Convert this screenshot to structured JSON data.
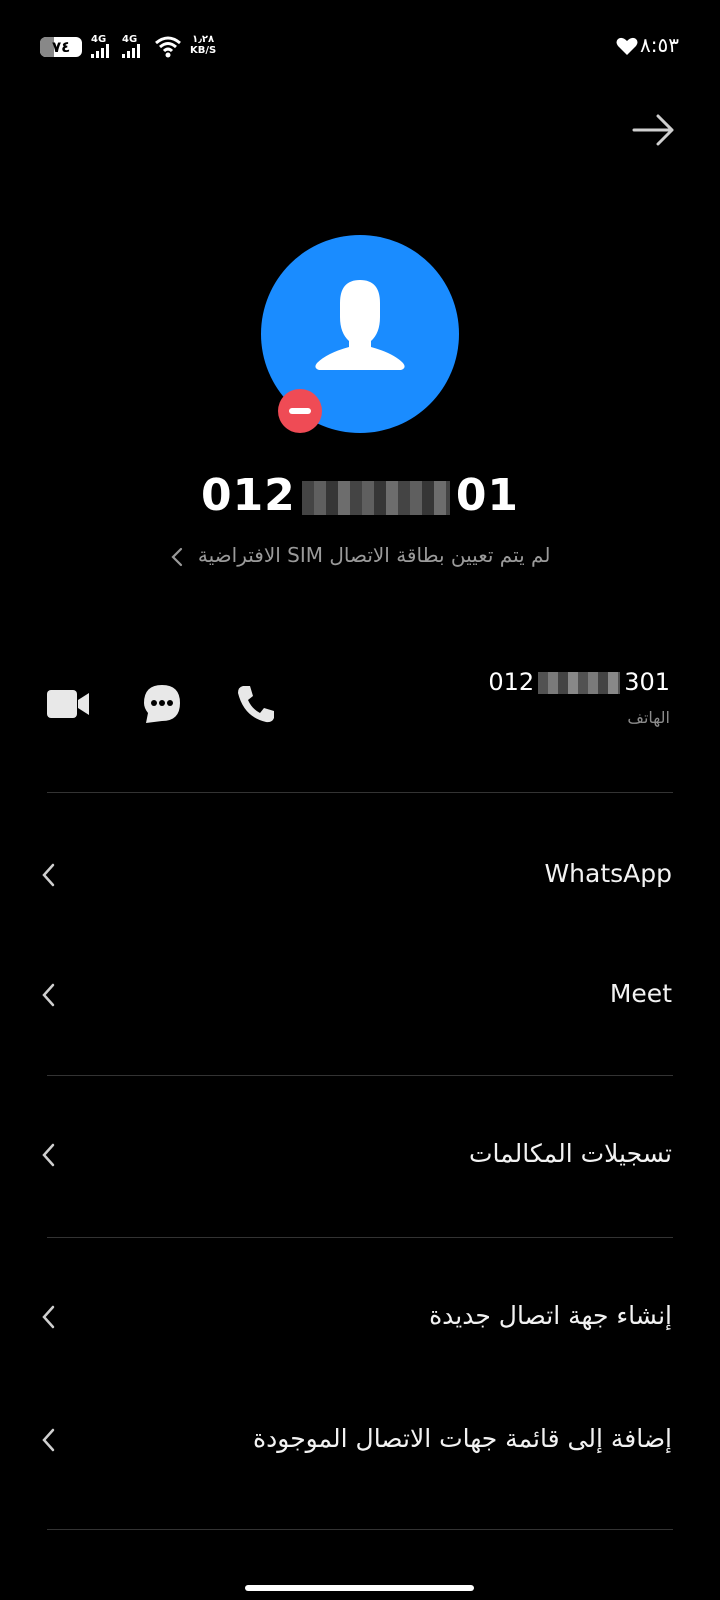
{
  "status_bar": {
    "battery": "٧٤",
    "net1": "4G",
    "net2": "4G",
    "speed_value": "١٫٢٨",
    "speed_unit": "KB/S",
    "time": "٨:٥٣"
  },
  "contact": {
    "number_prefix": "012",
    "number_suffix": "01",
    "sim_notice": "لم يتم تعيين بطاقة الاتصال SIM الافتراضية",
    "phone_prefix": "012",
    "phone_suffix": "301",
    "phone_label": "الهاتف"
  },
  "menu": {
    "whatsapp": "WhatsApp",
    "meet": "Meet",
    "call_recordings": "تسجيلات المكالمات",
    "create_contact": "إنشاء جهة اتصال جديدة",
    "add_existing": "إضافة إلى قائمة جهات الاتصال الموجودة"
  },
  "colors": {
    "avatar": "#1a8cff",
    "block_badge": "#ef4b55",
    "background": "#000000"
  },
  "icons": [
    "back-arrow-icon",
    "video-call-icon",
    "message-icon",
    "phone-icon",
    "chevron-left-icon",
    "heart-icon",
    "wifi-icon"
  ]
}
